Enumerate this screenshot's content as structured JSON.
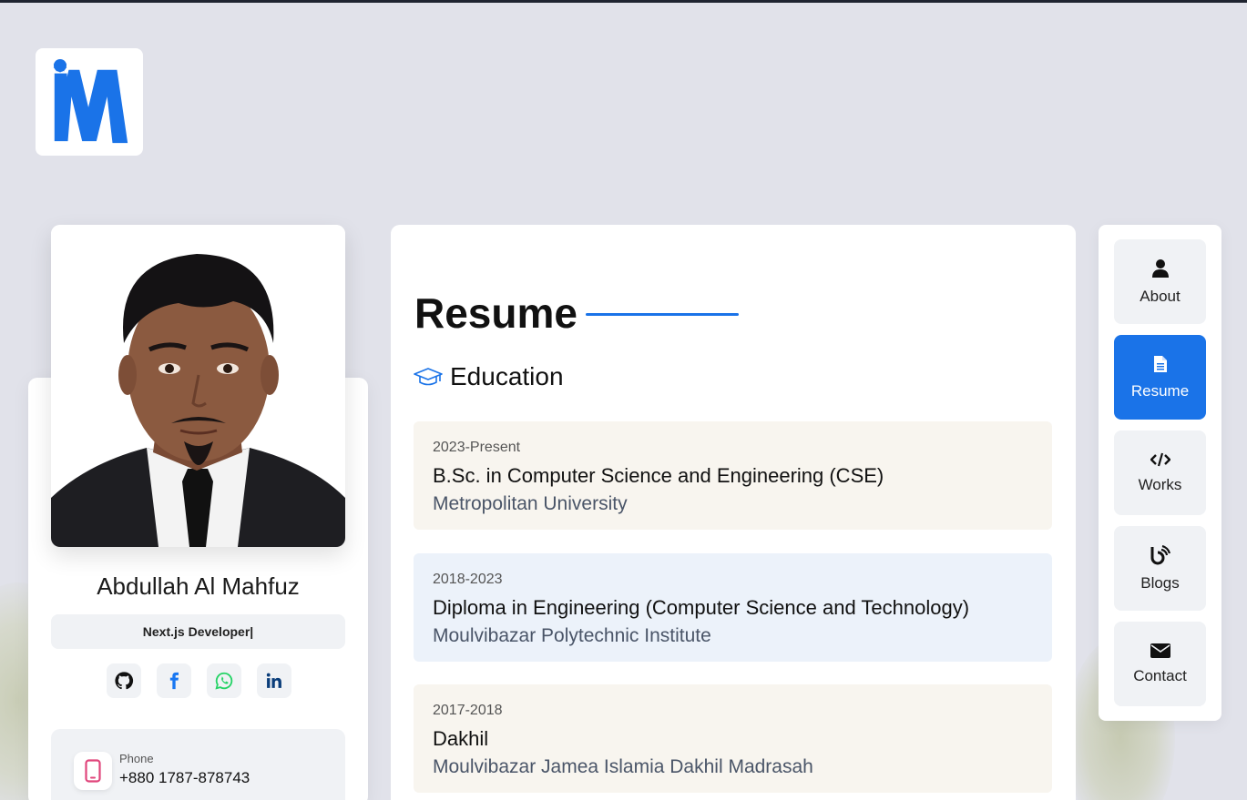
{
  "logo": {
    "icon": "im-logo-icon"
  },
  "profile": {
    "name": "Abdullah Al Mahfuz",
    "role": "Next.js Developer|",
    "socials": [
      {
        "name": "github",
        "icon": "github-icon"
      },
      {
        "name": "facebook",
        "icon": "facebook-icon"
      },
      {
        "name": "whatsapp",
        "icon": "whatsapp-icon"
      },
      {
        "name": "linkedin",
        "icon": "linkedin-icon"
      }
    ],
    "contact": {
      "label": "Phone",
      "value": "+880 1787-878743",
      "icon": "phone-icon"
    }
  },
  "main": {
    "title": "Resume",
    "education": {
      "heading": "Education",
      "icon": "graduation-cap-icon",
      "items": [
        {
          "years": "2023-Present",
          "degree": "B.Sc. in Computer Science and Engineering (CSE)",
          "institution": "Metropolitan University"
        },
        {
          "years": "2018-2023",
          "degree": "Diploma in Engineering (Computer Science and Technology)",
          "institution": "Moulvibazar Polytechnic Institute"
        },
        {
          "years": "2017-2018",
          "degree": "Dakhil",
          "institution": "Moulvibazar Jamea Islamia Dakhil Madrasah"
        }
      ]
    }
  },
  "nav": {
    "items": [
      {
        "label": "About",
        "icon": "user-icon",
        "active": false
      },
      {
        "label": "Resume",
        "icon": "document-icon",
        "active": true
      },
      {
        "label": "Works",
        "icon": "code-icon",
        "active": false
      },
      {
        "label": "Blogs",
        "icon": "blog-icon",
        "active": false
      },
      {
        "label": "Contact",
        "icon": "envelope-icon",
        "active": false
      }
    ]
  },
  "colors": {
    "accent": "#1a73e8",
    "background": "#e1e2ea",
    "phone_icon": "#e0457b"
  }
}
